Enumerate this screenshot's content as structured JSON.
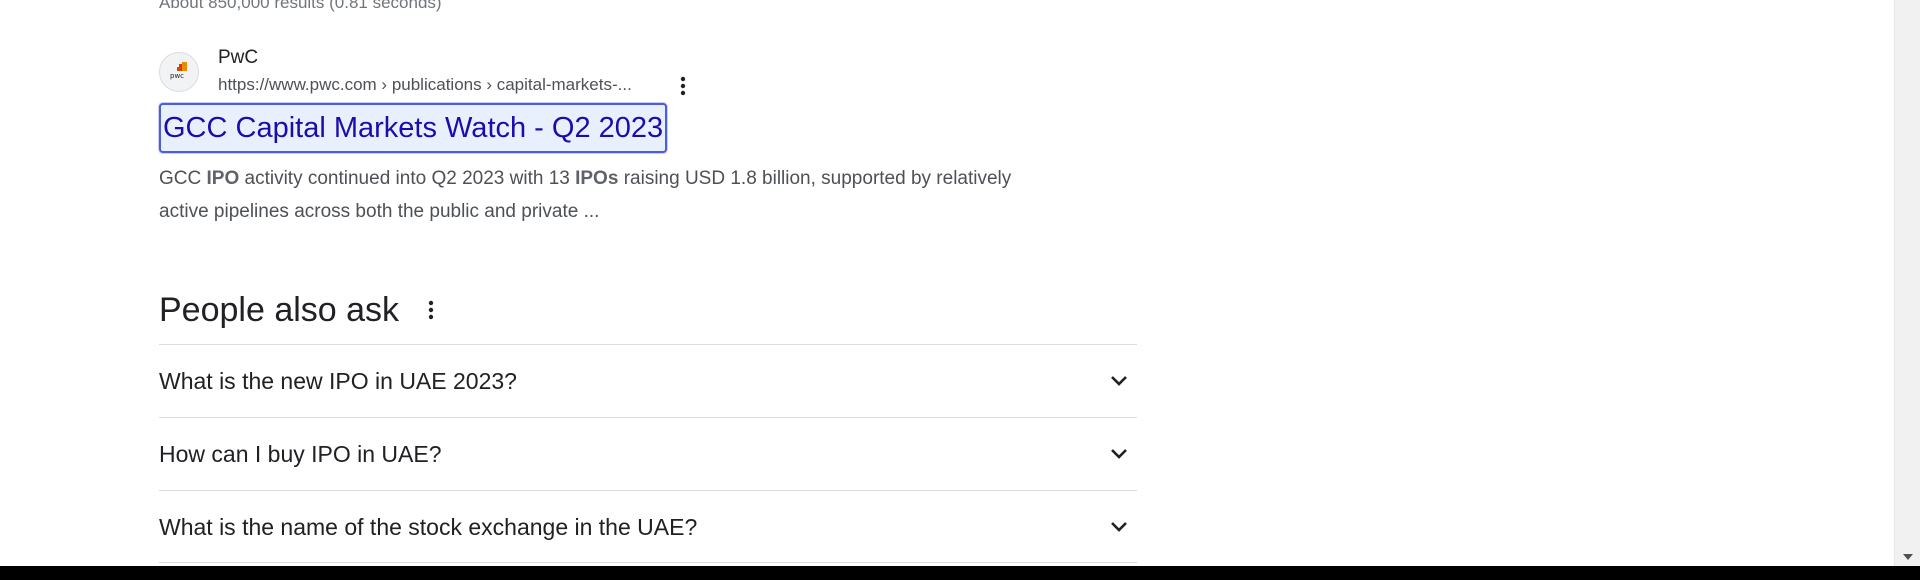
{
  "results": {
    "stats": "About 850,000 results (0.81 seconds)"
  },
  "result": {
    "source_name": "PwC",
    "source_url": "https://www.pwc.com › publications › capital-markets-...",
    "title": "GCC Capital Markets Watch - Q2 2023",
    "snippet": {
      "t1": "GCC ",
      "b1": "IPO",
      "t2": " activity continued into Q2 2023 with 13 ",
      "b2": "IPOs",
      "t3": " raising USD 1.8 billion, supported by relatively active pipelines across both the public and private ..."
    },
    "favicon_text": "pwc",
    "more_icon": "more-vert-icon"
  },
  "people_also_ask": {
    "heading": "People also ask",
    "menu_icon": "more-vert-icon",
    "questions": [
      "What is the new IPO in UAE 2023?",
      "How can I buy IPO in UAE?",
      "What is the name of the stock exchange in the UAE?"
    ],
    "chevron_icon": "chevron-down-icon"
  },
  "colors": {
    "link": "#1a0dab",
    "focus_ring": "#4c5edb",
    "focus_bg": "#e8f0fe",
    "text": "#202124",
    "muted": "#4d5156",
    "divider": "#dadce0"
  }
}
